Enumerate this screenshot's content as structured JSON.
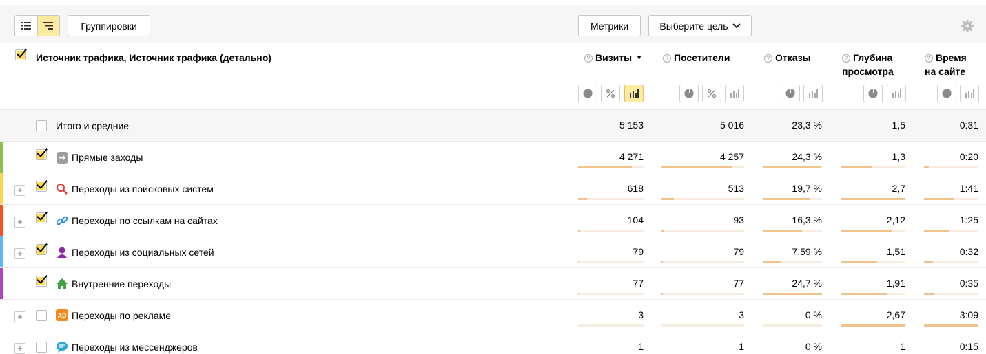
{
  "toolbar": {
    "groupings_label": "Группировки",
    "metrics_label": "Метрики",
    "goal_label": "Выберите цель"
  },
  "header": {
    "dimension_title": "Источник трафика, Источник трафика (детально)",
    "columns": [
      {
        "key": "visits",
        "line1": "Визиты",
        "line2": "",
        "sorted": true
      },
      {
        "key": "visitors",
        "line1": "Посетители",
        "line2": ""
      },
      {
        "key": "bounces",
        "line1": "Отказы",
        "line2": ""
      },
      {
        "key": "depth",
        "line1": "Глубина",
        "line2": "просмотра"
      },
      {
        "key": "time",
        "line1": "Время",
        "line2": "на сайте"
      }
    ],
    "help_glyph": "?",
    "sort_glyph": "▼"
  },
  "totals": {
    "label": "Итого и средние",
    "values": [
      "5 153",
      "5 016",
      "23,3 %",
      "1,5",
      "0:31"
    ]
  },
  "rows": [
    {
      "label": "Прямые заходы",
      "icon": "arrow-right-icon",
      "color": "#8bc34a",
      "checked": true,
      "expandable": false,
      "values": [
        "4 271",
        "4 257",
        "24,3 %",
        "1,3",
        "0:20"
      ],
      "bars": [
        0.82,
        0.85,
        0.98,
        0.48,
        0.09
      ]
    },
    {
      "label": "Переходы из поисковых систем",
      "icon": "search-icon",
      "color": "#ffd54f",
      "checked": true,
      "expandable": true,
      "values": [
        "618",
        "513",
        "19,7 %",
        "2,7",
        "1:41"
      ],
      "bars": [
        0.14,
        0.15,
        0.8,
        1.0,
        0.55
      ]
    },
    {
      "label": "Переходы по ссылкам на сайтах",
      "icon": "link-icon",
      "color": "#f4511e",
      "checked": true,
      "expandable": true,
      "values": [
        "104",
        "93",
        "16,3 %",
        "2,12",
        "1:25"
      ],
      "bars": [
        0.03,
        0.03,
        0.66,
        0.79,
        0.46
      ]
    },
    {
      "label": "Переходы из социальных сетей",
      "icon": "social-icon",
      "color": "#64b5f6",
      "checked": true,
      "expandable": true,
      "values": [
        "79",
        "79",
        "7,59 %",
        "1,51",
        "0:32"
      ],
      "bars": [
        0.02,
        0.02,
        0.31,
        0.56,
        0.17
      ]
    },
    {
      "label": "Внутренние переходы",
      "icon": "home-icon",
      "color": "#ab47bc",
      "checked": true,
      "expandable": false,
      "values": [
        "77",
        "77",
        "24,7 %",
        "1,91",
        "0:35"
      ],
      "bars": [
        0.02,
        0.02,
        1.0,
        0.71,
        0.19
      ]
    },
    {
      "label": "Переходы по рекламе",
      "icon": "ad-icon",
      "color": "",
      "checked": false,
      "expandable": true,
      "values": [
        "3",
        "3",
        "0 %",
        "2,67",
        "3:09"
      ],
      "bars": [
        0.0,
        0.0,
        0.0,
        0.99,
        1.0
      ]
    },
    {
      "label": "Переходы из мессенджеров",
      "icon": "messenger-icon",
      "color": "",
      "checked": false,
      "expandable": true,
      "values": [
        "1",
        "1",
        "0 %",
        "1",
        "0:15"
      ],
      "bars": [
        0.0,
        0.0,
        0.0,
        0.0,
        0.0
      ]
    }
  ],
  "icon_text": {
    "ad": "AD"
  }
}
